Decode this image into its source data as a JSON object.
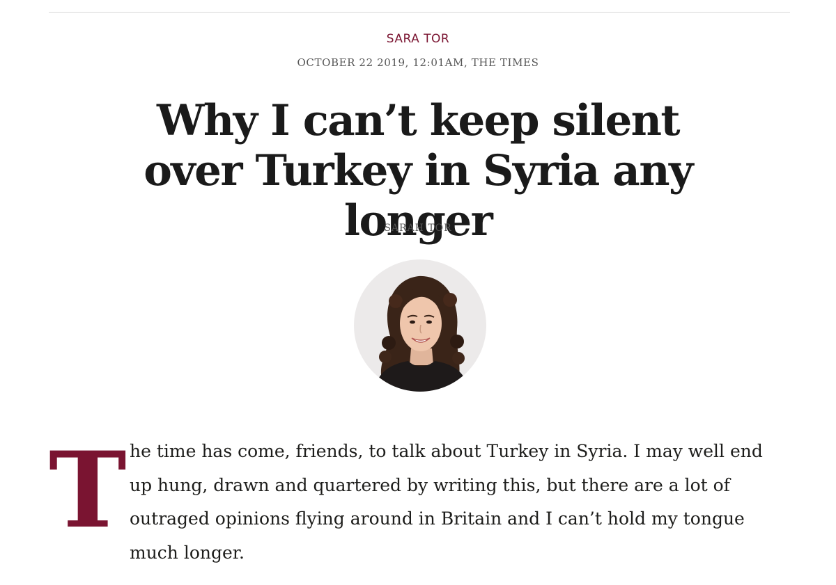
{
  "article": {
    "author_tag": "SARA TOR",
    "dateline": "OCTOBER 22 2019, 12:01AM, THE TIMES",
    "headline": "Why I can’t keep silent over Turkey in Syria any longer",
    "byline": "SARAH TOR",
    "drop_cap": "T",
    "first_paragraph_rest": "he time has come, friends, to talk about Turkey in Syria. I may well end up hung, drawn and quartered by writing this, but there are a lot of outraged opinions flying around in Britain and I can’t hold my tongue much longer."
  },
  "colors": {
    "accent": "#7a1431",
    "text": "#1d1d1b",
    "meta": "#555555",
    "rule": "#d8d8d8",
    "avatar_bg": "#eceaea"
  },
  "icons": {
    "author_photo": "author-portrait"
  }
}
